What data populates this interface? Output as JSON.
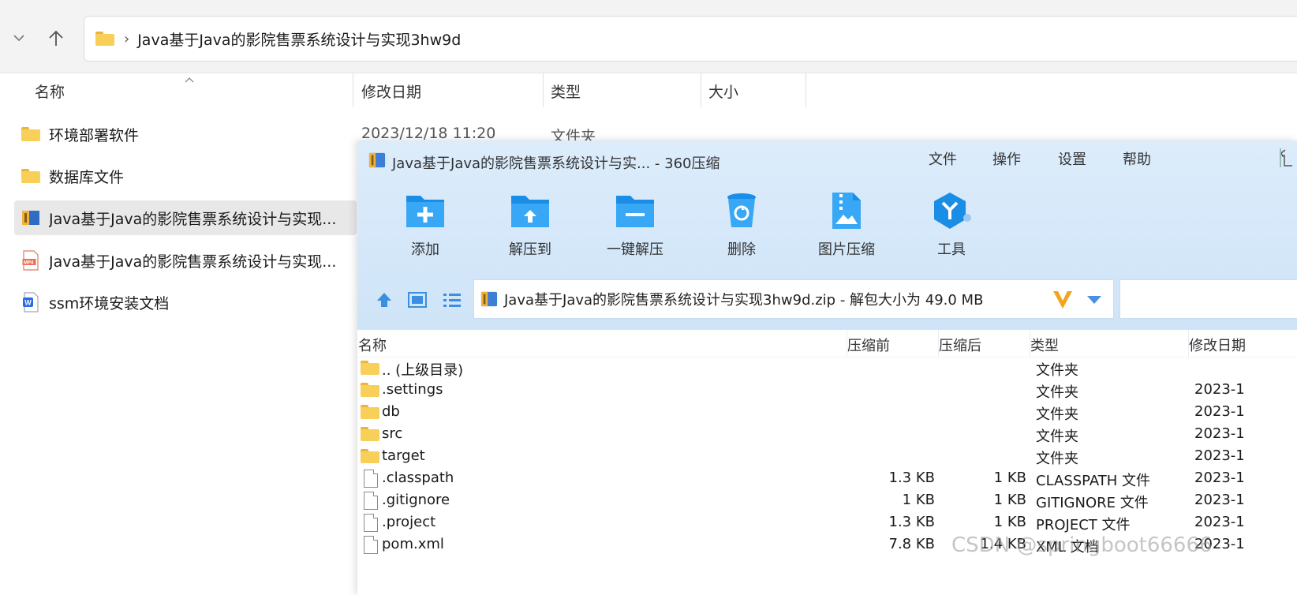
{
  "explorer": {
    "breadcrumb": "Java基于Java的影院售票系统设计与实现3hw9d",
    "columns": {
      "name": "名称",
      "modified": "修改日期",
      "type": "类型",
      "size": "大小"
    },
    "items": [
      {
        "name": "环境部署软件",
        "icon": "folder-icon",
        "date": "2023/12/18 11:20",
        "type": "文件夹"
      },
      {
        "name": "数据库文件",
        "icon": "folder-icon"
      },
      {
        "name": "Java基于Java的影院售票系统设计与实现...",
        "icon": "zip-archive-icon"
      },
      {
        "name": "Java基于Java的影院售票系统设计与实现...",
        "icon": "mp4-file-icon"
      },
      {
        "name": "ssm环境安装文档",
        "icon": "word-document-icon"
      }
    ]
  },
  "zip_window": {
    "title": "Java基于Java的影院售票系统设计与实... - 360压缩",
    "menu": [
      "文件",
      "操作",
      "设置",
      "帮助"
    ],
    "tools": [
      {
        "label": "添加",
        "icon": "add-folder-icon"
      },
      {
        "label": "解压到",
        "icon": "extract-to-icon"
      },
      {
        "label": "一键解压",
        "icon": "one-click-extract-icon"
      },
      {
        "label": "删除",
        "icon": "delete-icon"
      },
      {
        "label": "图片压缩",
        "icon": "image-compress-icon"
      },
      {
        "label": "工具",
        "icon": "tools-icon"
      }
    ],
    "path": "Java基于Java的影院售票系统设计与实现3hw9d.zip - 解包大小为 49.0 MB",
    "columns": {
      "name": "名称",
      "before": "压缩前",
      "after": "压缩后",
      "type": "类型",
      "modified": "修改日期"
    },
    "rows": [
      {
        "name": ".. (上级目录)",
        "before": "",
        "after": "",
        "type": "文件夹",
        "date": "",
        "icon": "folder-icon"
      },
      {
        "name": ".settings",
        "before": "",
        "after": "",
        "type": "文件夹",
        "date": "2023-1",
        "icon": "folder-icon"
      },
      {
        "name": "db",
        "before": "",
        "after": "",
        "type": "文件夹",
        "date": "2023-1",
        "icon": "folder-icon"
      },
      {
        "name": "src",
        "before": "",
        "after": "",
        "type": "文件夹",
        "date": "2023-1",
        "icon": "folder-icon"
      },
      {
        "name": "target",
        "before": "",
        "after": "",
        "type": "文件夹",
        "date": "2023-1",
        "icon": "folder-icon"
      },
      {
        "name": ".classpath",
        "before": "1.3 KB",
        "after": "1 KB",
        "type": "CLASSPATH 文件",
        "date": "2023-1",
        "icon": "file-icon"
      },
      {
        "name": ".gitignore",
        "before": "1 KB",
        "after": "1 KB",
        "type": "GITIGNORE 文件",
        "date": "2023-1",
        "icon": "file-icon"
      },
      {
        "name": ".project",
        "before": "1.3 KB",
        "after": "1 KB",
        "type": "PROJECT 文件",
        "date": "2023-1",
        "icon": "file-icon"
      },
      {
        "name": "pom.xml",
        "before": "7.8 KB",
        "after": "1.4 KB",
        "type": "XML 文档",
        "date": "2023-1",
        "icon": "file-icon"
      }
    ]
  },
  "watermark": "CSDN @springboot66666"
}
